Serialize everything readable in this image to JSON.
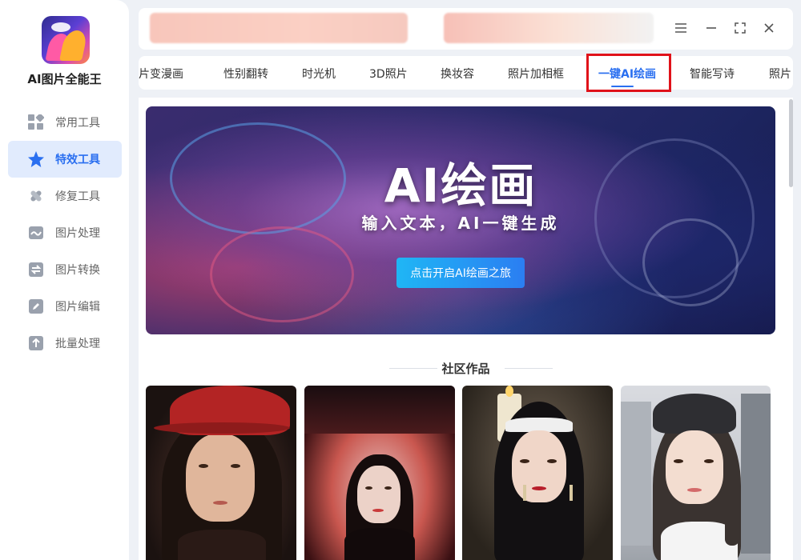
{
  "app": {
    "name": "AI图片全能王"
  },
  "sidebar": {
    "items": [
      {
        "label": "常用工具",
        "icon": "grid-icon",
        "active": false
      },
      {
        "label": "特效工具",
        "icon": "star-icon",
        "active": true
      },
      {
        "label": "修复工具",
        "icon": "bandage-icon",
        "active": false
      },
      {
        "label": "图片处理",
        "icon": "image-wave-icon",
        "active": false
      },
      {
        "label": "图片转换",
        "icon": "convert-icon",
        "active": false
      },
      {
        "label": "图片编辑",
        "icon": "edit-icon",
        "active": false
      },
      {
        "label": "批量处理",
        "icon": "upload-icon",
        "active": false
      }
    ]
  },
  "window": {
    "menu_icon": "hamburger-icon",
    "minimize_icon": "minimize-icon",
    "maximize_icon": "maximize-icon",
    "close_icon": "close-icon"
  },
  "tabs": [
    {
      "label": "照片变漫画"
    },
    {
      "label": "性别翻转"
    },
    {
      "label": "时光机"
    },
    {
      "label": "3D照片"
    },
    {
      "label": "换妆容"
    },
    {
      "label": "照片加相框"
    },
    {
      "label": "一键AI绘画",
      "active": true
    },
    {
      "label": "智能写诗"
    },
    {
      "label": "照片"
    }
  ],
  "banner": {
    "title": "AI绘画",
    "subtitle": "输入文本，AI一键生成",
    "cta": "点击开启AI绘画之旅"
  },
  "community": {
    "title": "社区作品"
  },
  "colors": {
    "accent": "#2a6ff0",
    "highlight": "#e0121a"
  }
}
